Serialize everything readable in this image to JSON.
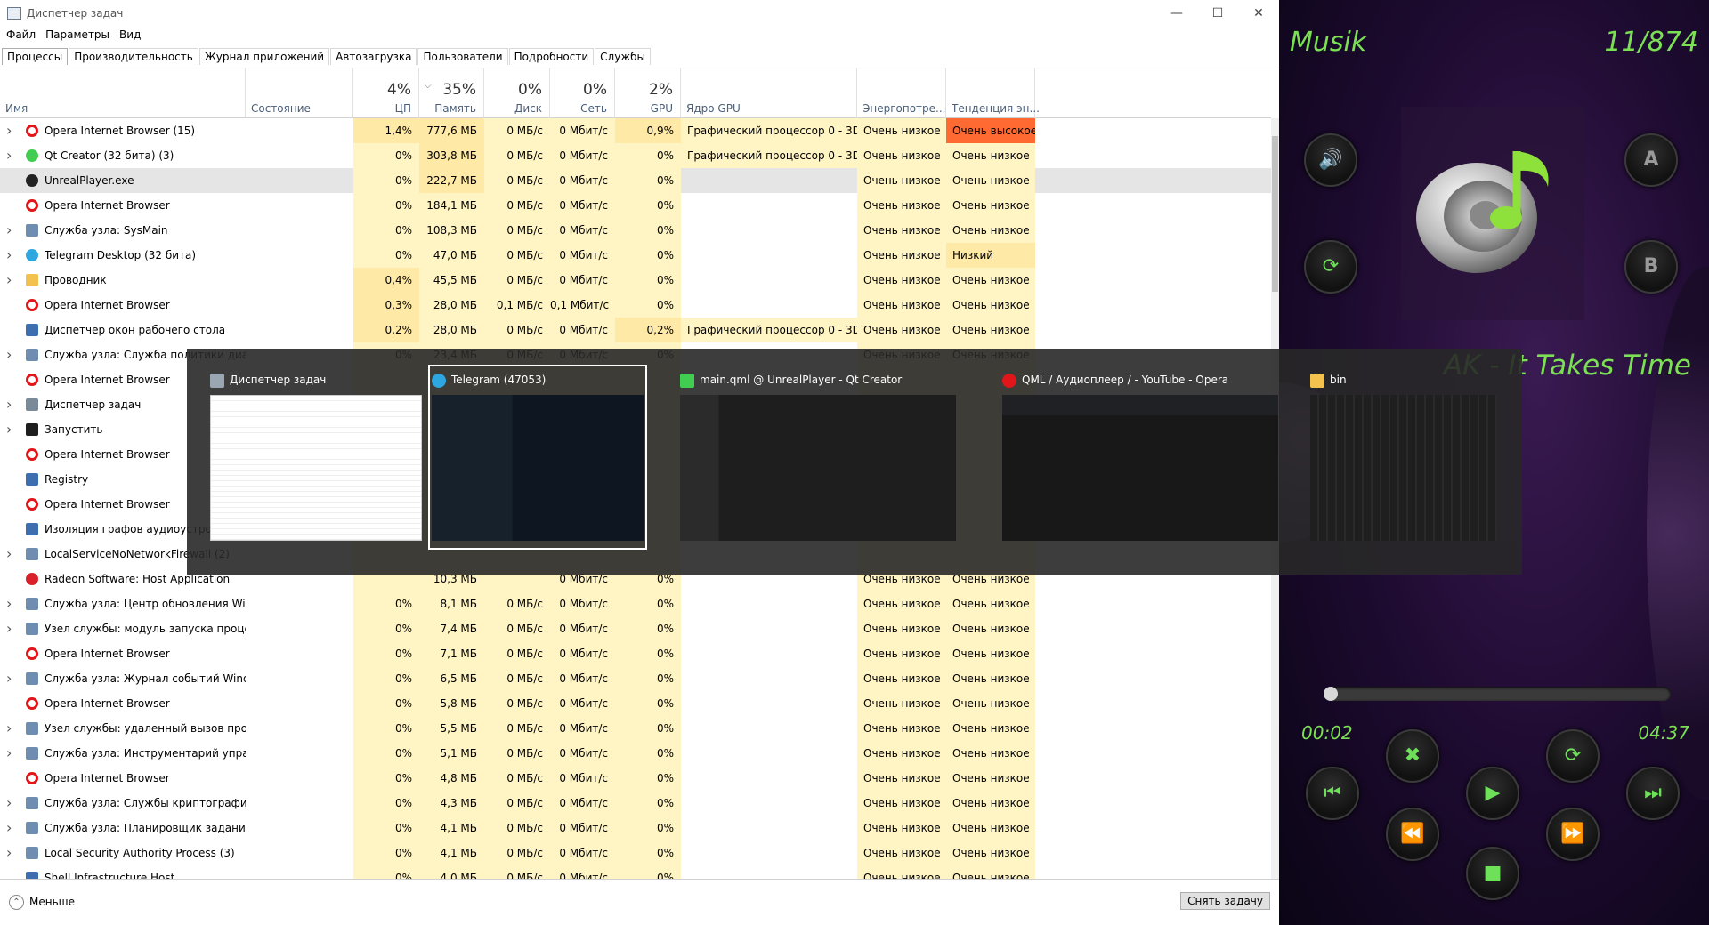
{
  "taskmgr": {
    "title": "Диспетчер задач",
    "menu": [
      "Файл",
      "Параметры",
      "Вид"
    ],
    "tabs": [
      "Процессы",
      "Производительность",
      "Журнал приложений",
      "Автозагрузка",
      "Пользователи",
      "Подробности",
      "Службы"
    ],
    "columns": [
      {
        "label": "Имя",
        "pct": ""
      },
      {
        "label": "Состояние",
        "pct": ""
      },
      {
        "label": "ЦП",
        "pct": "4%"
      },
      {
        "label": "Память",
        "pct": "35%"
      },
      {
        "label": "Диск",
        "pct": "0%"
      },
      {
        "label": "Сеть",
        "pct": "0%"
      },
      {
        "label": "GPU",
        "pct": "2%"
      },
      {
        "label": "Ядро GPU",
        "pct": ""
      },
      {
        "label": "Энергопотре...",
        "pct": ""
      },
      {
        "label": "Тенденция эн...",
        "pct": ""
      }
    ],
    "rows": [
      {
        "name": "Opera Internet Browser (15)",
        "icon": "opera",
        "exp": true,
        "cpu": "1,4%",
        "mem": "777,6 МБ",
        "disk": "0 МБ/с",
        "net": "0 Мбит/с",
        "gpu": "0,9%",
        "eng": "Графический процессор 0 - 3D",
        "pw": "Очень низкое",
        "tr": "Очень высокое",
        "trHot": true
      },
      {
        "name": "Qt Creator (32 бита) (3)",
        "icon": "qt",
        "exp": true,
        "cpu": "0%",
        "mem": "303,8 МБ",
        "disk": "0 МБ/с",
        "net": "0 Мбит/с",
        "gpu": "0%",
        "eng": "Графический процессор 0 - 3D",
        "pw": "Очень низкое",
        "tr": "Очень низкое"
      },
      {
        "name": "UnrealPlayer.exe",
        "icon": "player",
        "exp": false,
        "sel": true,
        "cpu": "0%",
        "mem": "222,7 МБ",
        "disk": "0 МБ/с",
        "net": "0 Мбит/с",
        "gpu": "0%",
        "eng": "",
        "pw": "Очень низкое",
        "tr": "Очень низкое"
      },
      {
        "name": "Opera Internet Browser",
        "icon": "opera",
        "exp": false,
        "cpu": "0%",
        "mem": "184,1 МБ",
        "disk": "0 МБ/с",
        "net": "0 Мбит/с",
        "gpu": "0%",
        "eng": "",
        "pw": "Очень низкое",
        "tr": "Очень низкое"
      },
      {
        "name": "Служба узла: SysMain",
        "icon": "gear",
        "exp": true,
        "cpu": "0%",
        "mem": "108,3 МБ",
        "disk": "0 МБ/с",
        "net": "0 Мбит/с",
        "gpu": "0%",
        "eng": "",
        "pw": "Очень низкое",
        "tr": "Очень низкое"
      },
      {
        "name": "Telegram Desktop (32 бита)",
        "icon": "telegram",
        "exp": true,
        "cpu": "0%",
        "mem": "47,0 МБ",
        "disk": "0 МБ/с",
        "net": "0 Мбит/с",
        "gpu": "0%",
        "eng": "",
        "pw": "Очень низкое",
        "tr": "Низкий"
      },
      {
        "name": "Проводник",
        "icon": "folder",
        "exp": true,
        "cpu": "0,4%",
        "mem": "45,5 МБ",
        "disk": "0 МБ/с",
        "net": "0 Мбит/с",
        "gpu": "0%",
        "eng": "",
        "pw": "Очень низкое",
        "tr": "Очень низкое"
      },
      {
        "name": "Opera Internet Browser",
        "icon": "opera",
        "exp": false,
        "cpu": "0,3%",
        "mem": "28,0 МБ",
        "disk": "0,1 МБ/с",
        "net": "0,1 Мбит/с",
        "gpu": "0%",
        "eng": "",
        "pw": "Очень низкое",
        "tr": "Очень низкое"
      },
      {
        "name": "Диспетчер окон рабочего стола",
        "icon": "window",
        "exp": false,
        "cpu": "0,2%",
        "mem": "28,0 МБ",
        "disk": "0 МБ/с",
        "net": "0 Мбит/с",
        "gpu": "0,2%",
        "eng": "Графический процессор 0 - 3D",
        "pw": "Очень низкое",
        "tr": "Очень низкое"
      },
      {
        "name": "Служба узла: Служба политики диагн...",
        "icon": "gear",
        "exp": true,
        "cpu": "0%",
        "mem": "23,4 МБ",
        "disk": "0 МБ/с",
        "net": "0 Мбит/с",
        "gpu": "0%",
        "eng": "",
        "pw": "Очень низкое",
        "tr": "Очень низкое"
      },
      {
        "name": "Opera Internet Browser",
        "icon": "opera",
        "exp": false,
        "cpu": "",
        "mem": "",
        "disk": "",
        "net": "",
        "gpu": "",
        "eng": "",
        "pw": "",
        "tr": ""
      },
      {
        "name": "Диспетчер задач",
        "icon": "taskmgr",
        "exp": true,
        "cpu": "",
        "mem": "",
        "disk": "",
        "net": "",
        "gpu": "",
        "eng": "",
        "pw": "",
        "tr": ""
      },
      {
        "name": "Запустить",
        "icon": "run",
        "exp": true,
        "cpu": "",
        "mem": "",
        "disk": "",
        "net": "",
        "gpu": "",
        "eng": "",
        "pw": "",
        "tr": ""
      },
      {
        "name": "Opera Internet Browser",
        "icon": "opera",
        "exp": false,
        "cpu": "",
        "mem": "",
        "disk": "",
        "net": "",
        "gpu": "",
        "eng": "",
        "pw": "",
        "tr": ""
      },
      {
        "name": "Registry",
        "icon": "window",
        "exp": false,
        "cpu": "",
        "mem": "",
        "disk": "",
        "net": "",
        "gpu": "",
        "eng": "",
        "pw": "",
        "tr": ""
      },
      {
        "name": "Opera Internet Browser",
        "icon": "opera",
        "exp": false,
        "cpu": "",
        "mem": "",
        "disk": "",
        "net": "",
        "gpu": "",
        "eng": "",
        "pw": "",
        "tr": ""
      },
      {
        "name": "Изоляция графов аудиоустройств",
        "icon": "window",
        "exp": false,
        "cpu": "",
        "mem": "",
        "disk": "",
        "net": "",
        "gpu": "",
        "eng": "",
        "pw": "",
        "tr": ""
      },
      {
        "name": "LocalServiceNoNetworkFirewall (2)",
        "icon": "gear",
        "exp": true,
        "cpu": "",
        "mem": "",
        "disk": "",
        "net": "",
        "gpu": "",
        "eng": "",
        "pw": "",
        "tr": ""
      },
      {
        "name": "Radeon Software: Host Application",
        "icon": "radeon",
        "exp": false,
        "cpu": "",
        "mem": "10,3 МБ",
        "disk": "",
        "net": "0 Мбит/с",
        "gpu": "0%",
        "eng": "",
        "pw": "Очень низкое",
        "tr": "Очень низкое"
      },
      {
        "name": "Служба узла: Центр обновления Wind...",
        "icon": "gear",
        "exp": true,
        "cpu": "0%",
        "mem": "8,1 МБ",
        "disk": "0 МБ/с",
        "net": "0 Мбит/с",
        "gpu": "0%",
        "eng": "",
        "pw": "Очень низкое",
        "tr": "Очень низкое"
      },
      {
        "name": "Узел службы: модуль запуска процес...",
        "icon": "gear",
        "exp": true,
        "cpu": "0%",
        "mem": "7,4 МБ",
        "disk": "0 МБ/с",
        "net": "0 Мбит/с",
        "gpu": "0%",
        "eng": "",
        "pw": "Очень низкое",
        "tr": "Очень низкое"
      },
      {
        "name": "Opera Internet Browser",
        "icon": "opera",
        "exp": false,
        "cpu": "0%",
        "mem": "7,1 МБ",
        "disk": "0 МБ/с",
        "net": "0 Мбит/с",
        "gpu": "0%",
        "eng": "",
        "pw": "Очень низкое",
        "tr": "Очень низкое"
      },
      {
        "name": "Служба узла: Журнал событий Windo...",
        "icon": "gear",
        "exp": true,
        "cpu": "0%",
        "mem": "6,5 МБ",
        "disk": "0 МБ/с",
        "net": "0 Мбит/с",
        "gpu": "0%",
        "eng": "",
        "pw": "Очень низкое",
        "tr": "Очень низкое"
      },
      {
        "name": "Opera Internet Browser",
        "icon": "opera",
        "exp": false,
        "cpu": "0%",
        "mem": "5,8 МБ",
        "disk": "0 МБ/с",
        "net": "0 Мбит/с",
        "gpu": "0%",
        "eng": "",
        "pw": "Очень низкое",
        "tr": "Очень низкое"
      },
      {
        "name": "Узел службы: удаленный вызов проц...",
        "icon": "gear",
        "exp": true,
        "cpu": "0%",
        "mem": "5,5 МБ",
        "disk": "0 МБ/с",
        "net": "0 Мбит/с",
        "gpu": "0%",
        "eng": "",
        "pw": "Очень низкое",
        "tr": "Очень низкое"
      },
      {
        "name": "Служба узла: Инструментарий управ...",
        "icon": "gear",
        "exp": true,
        "cpu": "0%",
        "mem": "5,1 МБ",
        "disk": "0 МБ/с",
        "net": "0 Мбит/с",
        "gpu": "0%",
        "eng": "",
        "pw": "Очень низкое",
        "tr": "Очень низкое"
      },
      {
        "name": "Opera Internet Browser",
        "icon": "opera",
        "exp": false,
        "cpu": "0%",
        "mem": "4,8 МБ",
        "disk": "0 МБ/с",
        "net": "0 Мбит/с",
        "gpu": "0%",
        "eng": "",
        "pw": "Очень низкое",
        "tr": "Очень низкое"
      },
      {
        "name": "Служба узла: Службы криптографии",
        "icon": "gear",
        "exp": true,
        "cpu": "0%",
        "mem": "4,3 МБ",
        "disk": "0 МБ/с",
        "net": "0 Мбит/с",
        "gpu": "0%",
        "eng": "",
        "pw": "Очень низкое",
        "tr": "Очень низкое"
      },
      {
        "name": "Служба узла: Планировщик заданий",
        "icon": "gear",
        "exp": true,
        "cpu": "0%",
        "mem": "4,1 МБ",
        "disk": "0 МБ/с",
        "net": "0 Мбит/с",
        "gpu": "0%",
        "eng": "",
        "pw": "Очень низкое",
        "tr": "Очень низкое"
      },
      {
        "name": "Local Security Authority Process (3)",
        "icon": "gear",
        "exp": true,
        "cpu": "0%",
        "mem": "4,1 МБ",
        "disk": "0 МБ/с",
        "net": "0 Мбит/с",
        "gpu": "0%",
        "eng": "",
        "pw": "Очень низкое",
        "tr": "Очень низкое"
      },
      {
        "name": "Shell Infrastructure Host",
        "icon": "window",
        "exp": false,
        "cpu": "0%",
        "mem": "4,0 МБ",
        "disk": "0 МБ/с",
        "net": "0 Мбит/с",
        "gpu": "0%",
        "eng": "",
        "pw": "Очень низкое",
        "tr": "Очень низкое"
      }
    ],
    "less_label": "Меньше",
    "end_task_label": "Снять задачу"
  },
  "switcher": {
    "windows": [
      {
        "title": "Диспетчер задач",
        "icon": "taskmgr-icon",
        "color": "#9aa6b2",
        "thumb": "light"
      },
      {
        "title": "Telegram (47053)",
        "icon": "telegram-icon",
        "color": "#2ea6df",
        "thumb": "tg",
        "selected": true
      },
      {
        "title": "main.qml @ UnrealPlayer - Qt Creator",
        "icon": "qt-icon",
        "color": "#41cd52",
        "thumb": "dark"
      },
      {
        "title": "QML / Аудиоплеер / - YouTube - Opera",
        "icon": "opera-icon",
        "color": "#e0161a",
        "thumb": "yt"
      },
      {
        "title": "bin",
        "icon": "folder-icon",
        "color": "#f2c14e",
        "thumb": "folder"
      }
    ]
  },
  "player": {
    "title": "Musik",
    "counter": "11/874",
    "song": "AK - It Takes Time",
    "time_current": "00:02",
    "time_total": "04:37",
    "progress": 0.02,
    "accent": "#6ee05a"
  }
}
